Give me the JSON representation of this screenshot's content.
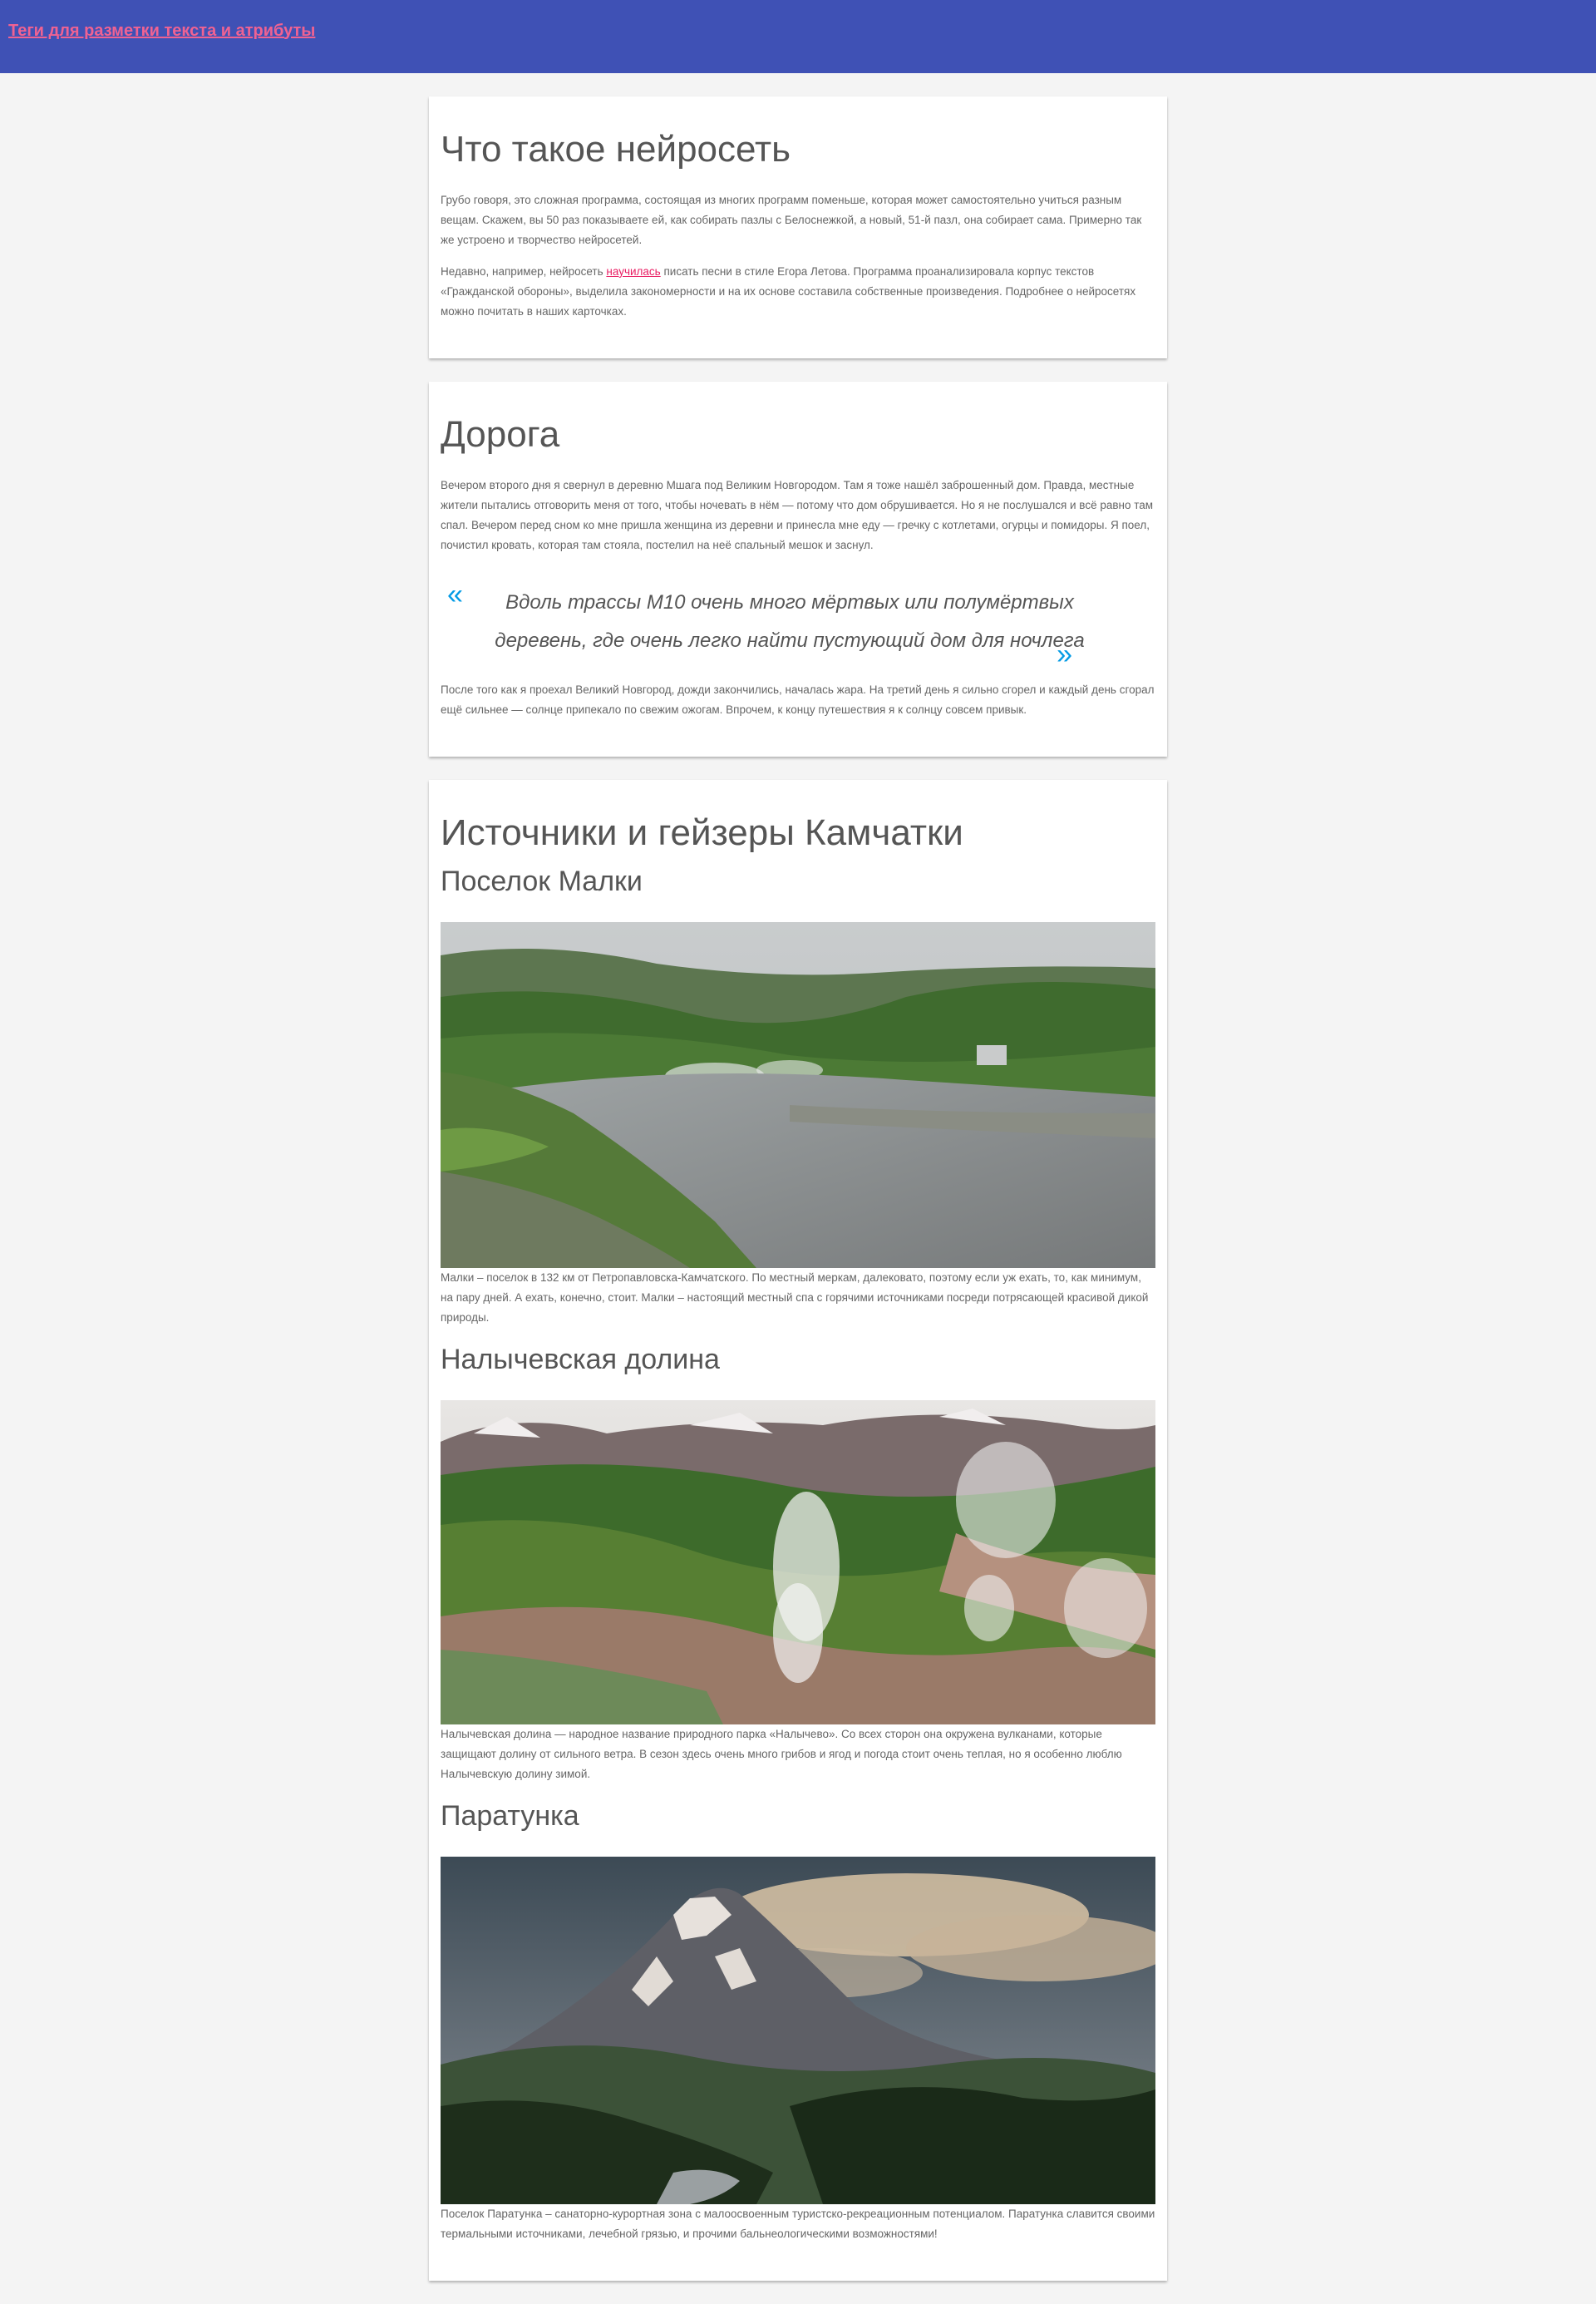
{
  "header": {
    "link_text": "Теги для разметки текста и атрибуты",
    "bg_color": "#3f51b5",
    "link_color": "#f06292"
  },
  "card1": {
    "title": "Что такое нейросеть",
    "p1": "Грубо говоря, это сложная программа, состоящая из многих программ поменьше, которая может самостоятельно учиться разным вещам. Скажем, вы 50 раз показываете ей, как собирать пазлы с Белоснежкой, а новый, 51-й пазл, она собирает сама. Примерно так же устроено и творчество нейросетей.",
    "p2_before": "Недавно, например, нейросеть ",
    "p2_link": "научилась",
    "p2_after": " писать песни в стиле Егора Летова. Программа проанализировала корпус текстов «Гражданской обороны», выделила закономерности и на их основе составила собственные произведения. Подробнее о нейросетях можно почитать в наших карточках."
  },
  "card2": {
    "title": "Дорога",
    "p1": "Вечером второго дня я свернул в деревню Мшага под Великим Новгородом. Там я тоже нашёл заброшенный дом. Правда, местные жители пытались отговорить меня от того, чтобы ночевать в нём — потому что дом обрушивается. Но я не послушался и всё равно там спал. Вечером перед сном ко мне пришла женщина из деревни и принесла мне еду — гречку с котлетами, огурцы и помидоры. Я поел, почистил кровать, которая там стояла, постелил на неё спальный мешок и заснул.",
    "quote_open": "«",
    "quote": "Вдоль трассы М10 очень много мёртвых или полумёртвых деревень, где очень легко найти пустующий дом для ночлега",
    "quote_close": "»",
    "p2": "После того как я проехал Великий Новгород, дожди закончились, началась жара. На третий день я сильно сгорел и каждый день сгорал ещё сильнее — солнце припекало по свежим ожогам. Впрочем, к концу путешествия я к солнцу совсем привык."
  },
  "card3": {
    "title": "Источники и гейзеры Камчатки",
    "sections": [
      {
        "subtitle": "Поселок Малки",
        "caption": "Малки – поселок в 132 км от Петропавловска-Камчатского. По местный меркам, далековато, поэтому если уж ехать, то, как минимум, на пару дней. А ехать, конечно, стоит. Малки – настоящий местный спа с горячими источниками посреди потрясающей красивой дикой природы."
      },
      {
        "subtitle": "Налычевская долина",
        "caption": "Налычевская долина — народное название природного парка «Налычево». Со всех сторон она окружена вулканами, которые защищают долину от сильного ветра. В сезон здесь очень много грибов и ягод и погода стоит очень теплая, но я особенно люблю Налычевскую долину зимой."
      },
      {
        "subtitle": "Паратунка",
        "caption": "Поселок Паратунка – санаторно-курортная зона с малоосвоенным туристско-рекреационным потенциалом. Паратунка славится своими термальными источниками, лечебной грязью, и прочими бальнеологическими возможностями!"
      }
    ]
  }
}
